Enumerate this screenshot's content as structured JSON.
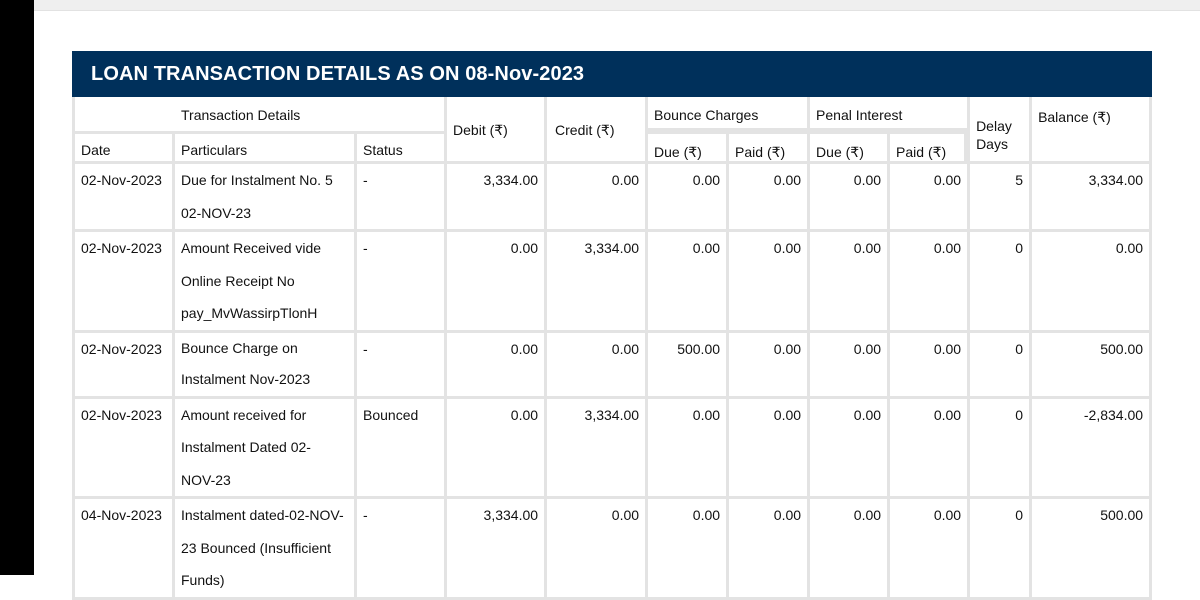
{
  "title": "LOAN TRANSACTION DETAILS AS ON 08-Nov-2023",
  "headers": {
    "transaction_details": "Transaction Details",
    "date": "Date",
    "particulars": "Particulars",
    "status": "Status",
    "debit": "Debit (₹)",
    "credit": "Credit (₹)",
    "bounce_charges": "Bounce Charges",
    "penal_interest": "Penal Interest",
    "bounce_due": "Due (₹)",
    "bounce_paid": "Paid (₹)",
    "penal_due": "Due (₹)",
    "penal_paid": "Paid (₹)",
    "delay_days_line1": "Delay",
    "delay_days_line2": "Days",
    "balance": "Balance (₹)"
  },
  "rows": [
    {
      "date": "02-Nov-2023",
      "particulars": [
        "Due for Instalment No. 5",
        "02-NOV-23"
      ],
      "status": "-",
      "debit": "3,334.00",
      "credit": "0.00",
      "bounce_due": "0.00",
      "bounce_paid": "0.00",
      "penal_due": "0.00",
      "penal_paid": "0.00",
      "delay_days": "5",
      "balance": "3,334.00"
    },
    {
      "date": "02-Nov-2023",
      "particulars": [
        "Amount Received vide",
        "Online Receipt No",
        "pay_MvWassirpTlonH"
      ],
      "status": "-",
      "debit": "0.00",
      "credit": "3,334.00",
      "bounce_due": "0.00",
      "bounce_paid": "0.00",
      "penal_due": "0.00",
      "penal_paid": "0.00",
      "delay_days": "0",
      "balance": "0.00"
    },
    {
      "date": "02-Nov-2023",
      "particulars": [
        "Bounce Charge on",
        "Instalment Nov-2023"
      ],
      "status": "-",
      "debit": "0.00",
      "credit": "0.00",
      "bounce_due": "500.00",
      "bounce_paid": "0.00",
      "penal_due": "0.00",
      "penal_paid": "0.00",
      "delay_days": "0",
      "balance": "500.00"
    },
    {
      "date": "02-Nov-2023",
      "particulars": [
        "Amount received for",
        "Instalment Dated 02-",
        "NOV-23"
      ],
      "status": "Bounced",
      "debit": "0.00",
      "credit": "3,334.00",
      "bounce_due": "0.00",
      "bounce_paid": "0.00",
      "penal_due": "0.00",
      "penal_paid": "0.00",
      "delay_days": "0",
      "balance": "-2,834.00"
    },
    {
      "date": "04-Nov-2023",
      "particulars": [
        "Instalment dated-02-NOV-",
        "23 Bounced (Insufficient",
        "Funds)"
      ],
      "status": "-",
      "debit": "3,334.00",
      "credit": "0.00",
      "bounce_due": "0.00",
      "bounce_paid": "0.00",
      "penal_due": "0.00",
      "penal_paid": "0.00",
      "delay_days": "0",
      "balance": "500.00"
    }
  ]
}
